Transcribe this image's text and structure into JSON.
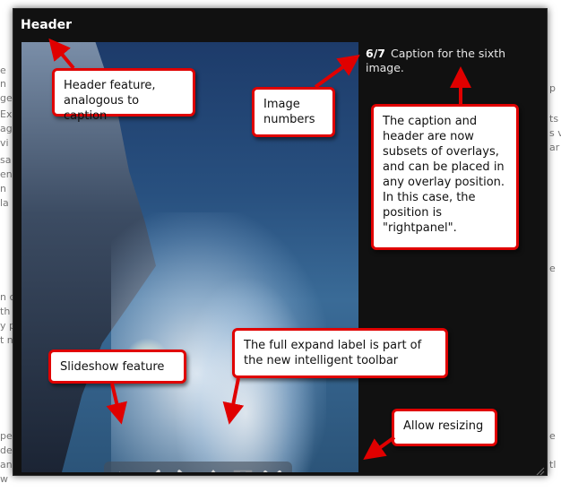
{
  "viewer": {
    "header": "Header",
    "image_number": "6/7",
    "caption": "Caption for the sixth image."
  },
  "toolbar": {
    "play_icon": "play-icon",
    "previous_icon": "chevron-left-icon",
    "next_icon": "chevron-right-icon",
    "move_icon": "move-icon",
    "expand_icon": "full-expand-icon",
    "close_icon": "close-icon"
  },
  "annotations": {
    "header": "Header feature, analogous to caption",
    "image_numbers": "Image numbers",
    "caption_overlay": "The caption and header are now subsets of overlays, and can be placed in any overlay position. In this case, the position is \"rightpanel\".",
    "slideshow": "Slideshow feature",
    "full_expand": "The full expand label is part of the new intelligent toolbar",
    "resizing": "Allow resizing"
  },
  "colors": {
    "annotation_border": "#e00000",
    "viewer_bg": "#111111",
    "toolbar_bg": "#464e5a"
  }
}
